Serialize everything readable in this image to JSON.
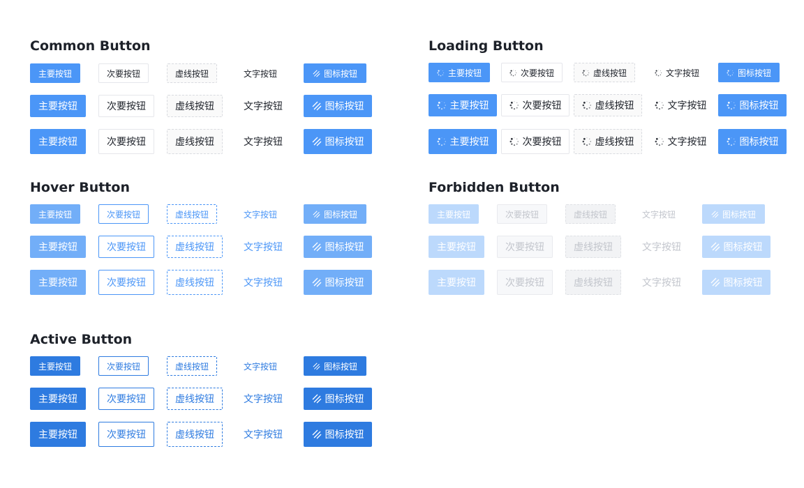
{
  "labels": {
    "primary": "主要按钮",
    "secondary": "次要按钮",
    "dashed": "虚线按钮",
    "text": "文字按钮",
    "icon": "图标按钮"
  },
  "icons": {
    "icon_button": "stripes-icon",
    "loading": "loading-spinner-icon"
  },
  "colors": {
    "primary": "#4b96f7",
    "hover": "#72aef8",
    "active": "#2e7be0",
    "disabled": "#bcd9fc",
    "text_dark": "#1d2129",
    "text_disabled": "#c2c5cc"
  },
  "sections": {
    "common": {
      "title": "Common  Button"
    },
    "loading": {
      "title": "Loading  Button"
    },
    "hover": {
      "title": "Hover  Button"
    },
    "forbidden": {
      "title": "Forbidden  Button"
    },
    "active": {
      "title": "Active  Button"
    }
  }
}
